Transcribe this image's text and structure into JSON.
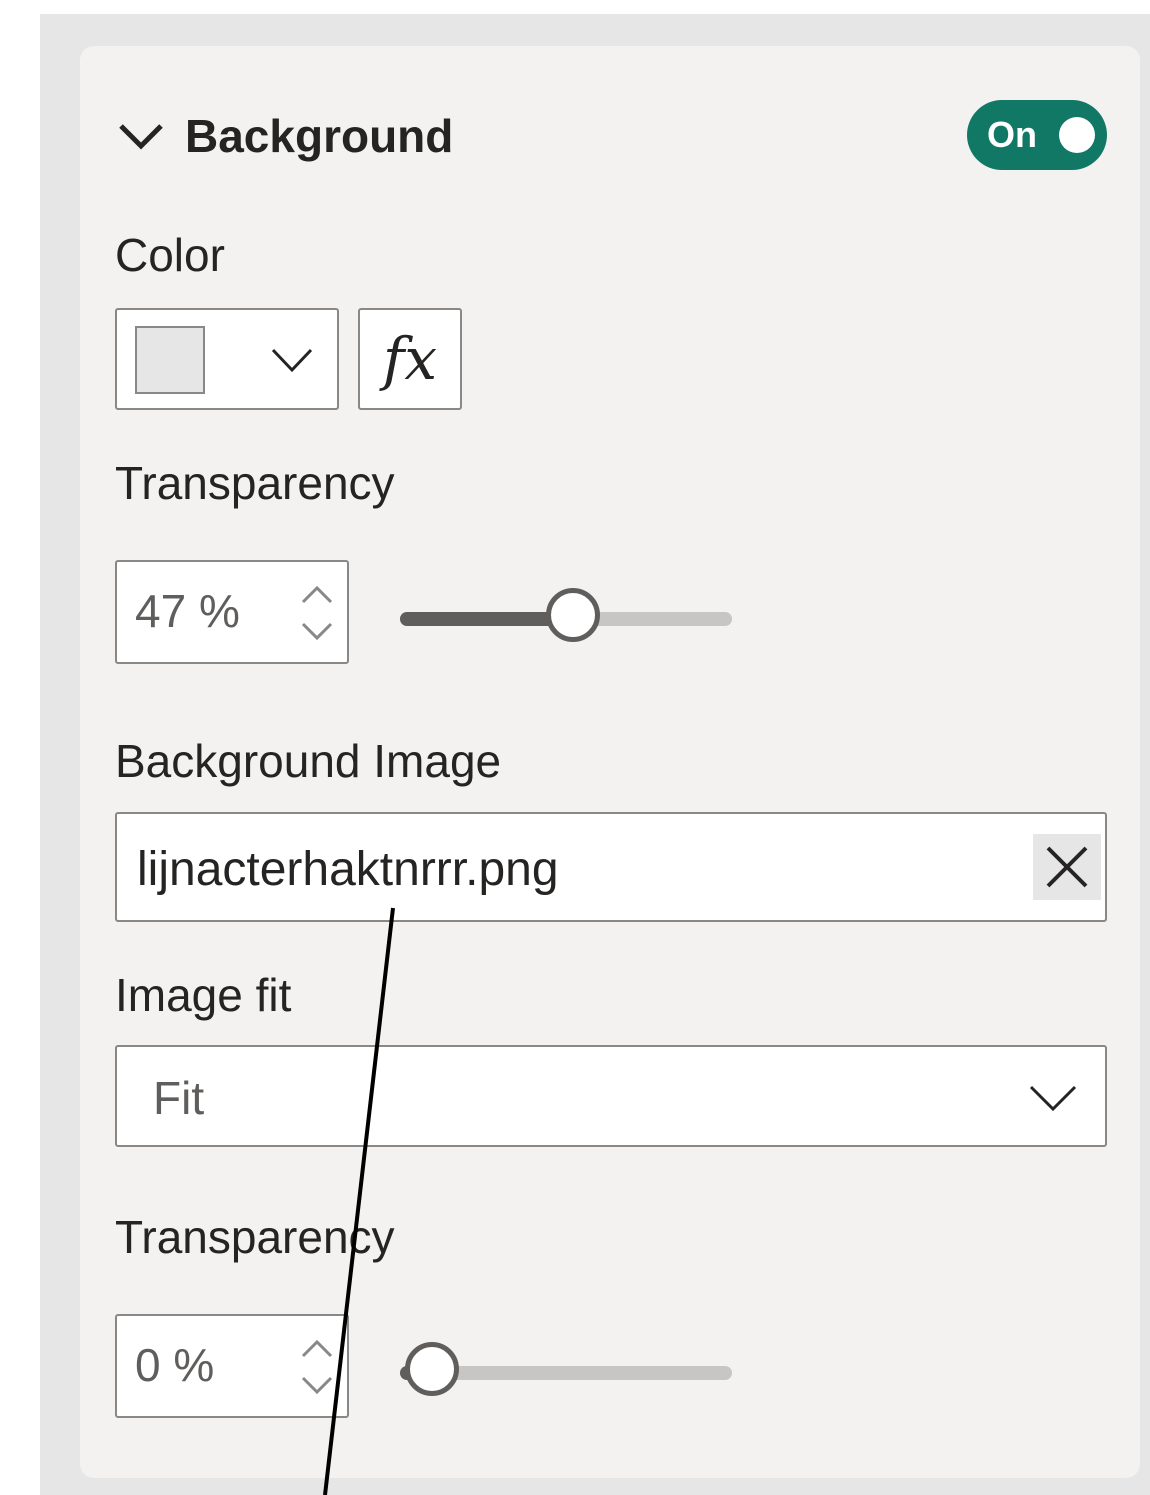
{
  "background_section": {
    "title": "Background",
    "toggle_label": "On",
    "toggle_state": "on",
    "color_label": "Color",
    "color_swatch_value": "#e6e6e6",
    "fx_label": "fx",
    "transparency_label": "Transparency",
    "transparency_value": "47 %",
    "transparency_level": 0.47,
    "image_label": "Background Image",
    "image_file": "lijnacterhaktnrrr.png",
    "image_fit_label": "Image fit",
    "image_fit_value": "Fit",
    "image_transparency_label": "Transparency",
    "image_transparency_value": "0 %",
    "image_transparency_level": 0.0
  },
  "colors": {
    "toggle_on": "#117865",
    "panel": "#f3f2f1",
    "outer": "#e6e6e6"
  },
  "icons": {
    "section_collapse": "chevron-down-icon",
    "color_dropdown": "chevron-down-icon",
    "clear": "close-icon",
    "select": "chevron-down-icon",
    "spinner": "spin-arrows-icon"
  }
}
